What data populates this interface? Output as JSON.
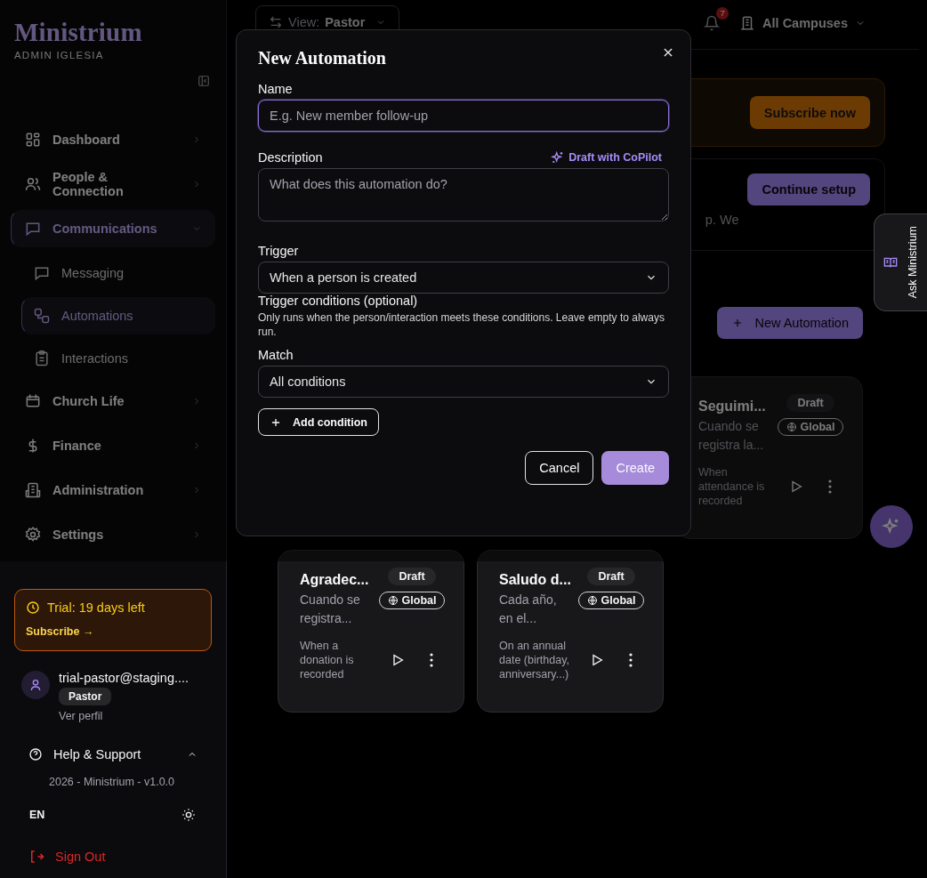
{
  "sidebar": {
    "logo": "Ministrium",
    "subtitle": "ADMIN IGLESIA",
    "nav": [
      {
        "label": "Dashboard",
        "expanded": false
      },
      {
        "label": "People & Connection",
        "expanded": false
      },
      {
        "label": "Communications",
        "expanded": true,
        "children": [
          {
            "label": "Messaging",
            "selected": false
          },
          {
            "label": "Automations",
            "selected": true
          },
          {
            "label": "Interactions",
            "selected": false
          }
        ]
      },
      {
        "label": "Church Life",
        "expanded": false
      },
      {
        "label": "Finance",
        "expanded": false
      },
      {
        "label": "Administration",
        "expanded": false
      },
      {
        "label": "Settings",
        "expanded": false
      }
    ],
    "trial": {
      "title": "Trial: 19 days left",
      "link": "Subscribe →"
    },
    "user": {
      "email": "trial-pastor@staging....",
      "role": "Pastor",
      "profile_link": "Ver perfil"
    },
    "help": {
      "label": "Help & Support",
      "expanded": true,
      "version": "2026 - Ministrium - v1.0.0"
    },
    "language": "EN",
    "sign_out": "Sign Out"
  },
  "header": {
    "view_label": "View:",
    "view_value": "Pastor",
    "notifications": "7",
    "campus": "All Campuses"
  },
  "banner": {
    "button": "Subscribe now"
  },
  "setup": {
    "text": "p. We",
    "button": "Continue setup"
  },
  "new_automation_button": "New Automation",
  "automations": [
    {
      "title": "Seguimi...",
      "status": "Draft",
      "scope": "Global",
      "description": "Cuando se registra la...",
      "trigger": "When attendance is recorded"
    },
    {
      "title": "Agradec...",
      "status": "Draft",
      "scope": "Global",
      "description": "Cuando se registra...",
      "trigger": "When a donation is recorded"
    },
    {
      "title": "Saludo d...",
      "status": "Draft",
      "scope": "Global",
      "description": "Cada año, en el...",
      "trigger": "On an annual date (birthday, anniversary...)"
    }
  ],
  "ask_tab": "Ask Ministrium",
  "dialog": {
    "title": "New Automation",
    "name_label": "Name",
    "name_placeholder": "E.g. New member follow-up",
    "description_label": "Description",
    "copilot_link": "Draft with CoPilot",
    "description_placeholder": "What does this automation do?",
    "trigger_label": "Trigger",
    "trigger_value": "When a person is created",
    "conditions_label": "Trigger conditions (optional)",
    "conditions_help": "Only runs when the person/interaction meets these conditions. Leave empty to always run.",
    "match_label": "Match",
    "match_value": "All conditions",
    "add_condition": "Add condition",
    "cancel": "Cancel",
    "create": "Create"
  }
}
